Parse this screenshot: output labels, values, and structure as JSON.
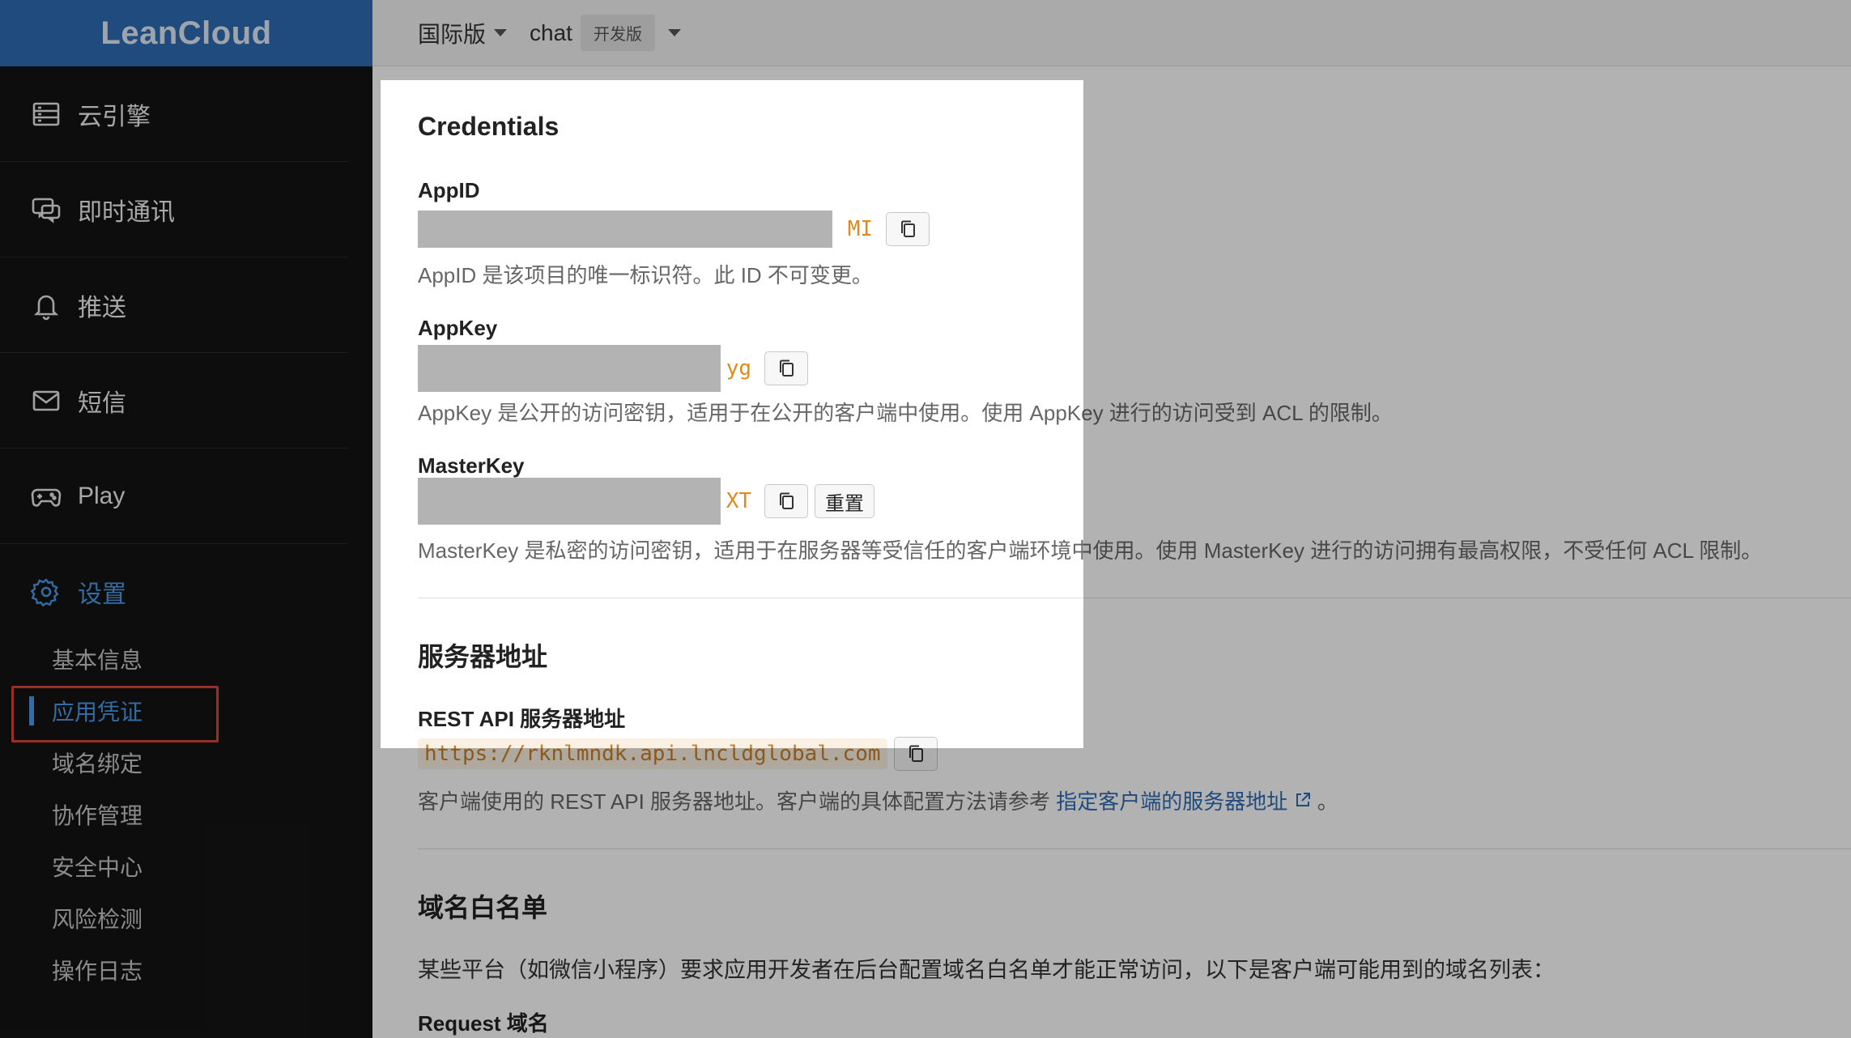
{
  "brand": {
    "name": "LeanCloud"
  },
  "topbar": {
    "region": "国际版",
    "app_name": "chat",
    "app_badge": "开发版"
  },
  "sidebar": {
    "items": [
      {
        "label": "云引擎",
        "icon": "server-icon"
      },
      {
        "label": "即时通讯",
        "icon": "chat-icon"
      },
      {
        "label": "推送",
        "icon": "bell-icon"
      },
      {
        "label": "短信",
        "icon": "mail-icon"
      },
      {
        "label": "Play",
        "icon": "gamepad-icon"
      },
      {
        "label": "设置",
        "icon": "gear-icon",
        "active": true
      }
    ],
    "sub_items": [
      {
        "label": "基本信息"
      },
      {
        "label": "应用凭证",
        "current": true
      },
      {
        "label": "域名绑定"
      },
      {
        "label": "协作管理"
      },
      {
        "label": "安全中心"
      },
      {
        "label": "风险检测"
      },
      {
        "label": "操作日志"
      }
    ]
  },
  "credentials": {
    "title": "Credentials",
    "appid": {
      "label": "AppID",
      "visible_suffix": "MI",
      "help": "AppID 是该项目的唯一标识符。此 ID 不可变更。"
    },
    "appkey": {
      "label": "AppKey",
      "visible_suffix": "yg",
      "help": "AppKey 是公开的访问密钥，适用于在公开的客户端中使用。使用 AppKey 进行的访问受到 ACL 的限制。"
    },
    "masterkey": {
      "label": "MasterKey",
      "visible_suffix": "XT",
      "reset_label": "重置",
      "help": "MasterKey 是私密的访问密钥，适用于在服务器等受信任的客户端环境中使用。使用 MasterKey 进行的访问拥有最高权限，不受任何 ACL 限制。"
    }
  },
  "server": {
    "title": "服务器地址",
    "rest_label": "REST API 服务器地址",
    "rest_url": "https://rknlmndk.api.lncldglobal.com",
    "help_prefix": "客户端使用的 REST API 服务器地址。客户端的具体配置方法请参考",
    "help_link": "指定客户端的服务器地址",
    "help_suffix": "。"
  },
  "whitelist": {
    "title": "域名白名单",
    "description": "某些平台（如微信小程序）要求应用开发者在后台配置域名白名单才能正常访问，以下是客户端可能用到的域名列表：",
    "request_label": "Request 域名"
  },
  "colors": {
    "brand_blue": "#2f6cb5",
    "active_blue": "#4a9be8",
    "key_orange": "#e08a1a",
    "highlight_red": "#e0433a"
  }
}
